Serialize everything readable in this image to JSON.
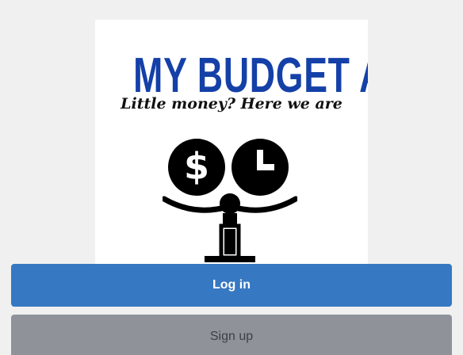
{
  "logo": {
    "title": "MY BUDGET APP",
    "tagline": "Little money? Here we are",
    "title_color": "#1440a8",
    "illustration_icon": "money-clock-balance-scale-icon"
  },
  "actions": {
    "login_label": "Log in",
    "signup_label": "Sign up",
    "login_color": "#3778c2",
    "signup_color": "#8f9399"
  }
}
